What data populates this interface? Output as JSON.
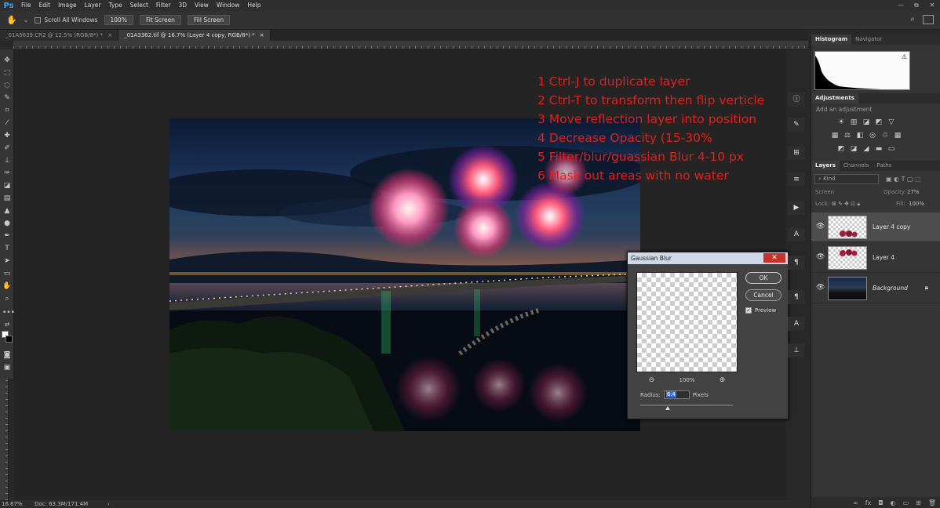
{
  "app": {
    "logo": "Ps"
  },
  "menu": [
    "File",
    "Edit",
    "Image",
    "Layer",
    "Type",
    "Select",
    "Filter",
    "3D",
    "View",
    "Window",
    "Help"
  ],
  "window_controls": [
    "—",
    "⧉",
    "✕"
  ],
  "options_bar": {
    "scroll_all_windows": "Scroll All Windows",
    "zoom_button": "100%",
    "fit_screen": "Fit Screen",
    "fill_screen": "Fill Screen"
  },
  "tabs": [
    {
      "label": "_01A5639.CR2 @ 12.5% (RGB/8*) *",
      "active": false
    },
    {
      "label": "_01A3362.tif @ 16.7% (Layer 4 copy, RGB/8*) *",
      "active": true
    }
  ],
  "tab_close": "×",
  "annotation": [
    "1 Ctrl-J to duplicate layer",
    "2 Ctrl-T to transform then flip verticle",
    "3 Move reflection layer into position",
    "4 Decrease Opacity (15-30%",
    "5 Filter/blur/guassian Blur 4-10 px",
    "6 Mask out areas with no water"
  ],
  "dialog": {
    "title": "Gaussian Blur",
    "close": "✕",
    "ok": "OK",
    "cancel": "Cancel",
    "preview_label": "Preview",
    "preview_checked": "✓",
    "zoom_level": "100%",
    "radius_label": "Radius:",
    "radius_value": "6.4",
    "radius_unit": "Pixels",
    "radius_slider_fraction": 0.3
  },
  "panels": {
    "histogram_tabs": [
      "Histogram",
      "Navigator"
    ],
    "histogram_warning": "⚠",
    "adjustments_tab": "Adjustments",
    "add_adjustment": "Add an adjustment",
    "layers_tabs": [
      "Layers",
      "Channels",
      "Paths"
    ],
    "kind_filter": "Kind",
    "blend_mode": "Screen",
    "opacity_label": "Opacity:",
    "opacity_value": "27%",
    "lock_label": "Lock:",
    "fill_label": "Fill:",
    "fill_value": "100%",
    "layers": [
      {
        "name": "Layer 4 copy",
        "selected": true,
        "thumb": "transparent",
        "italic": false
      },
      {
        "name": "Layer 4",
        "selected": false,
        "thumb": "transparent",
        "italic": false
      },
      {
        "name": "Background",
        "selected": false,
        "thumb": "photo",
        "italic": true
      }
    ]
  },
  "status": {
    "zoom": "16.67%",
    "doc": "Doc: 63.3M/171.4M"
  },
  "colors": {
    "annotation_red": "#e0201e",
    "ps_blue": "#3ba3f5",
    "dialog_close_red": "#c8312a",
    "radius_highlight": "#3c6fd0"
  }
}
